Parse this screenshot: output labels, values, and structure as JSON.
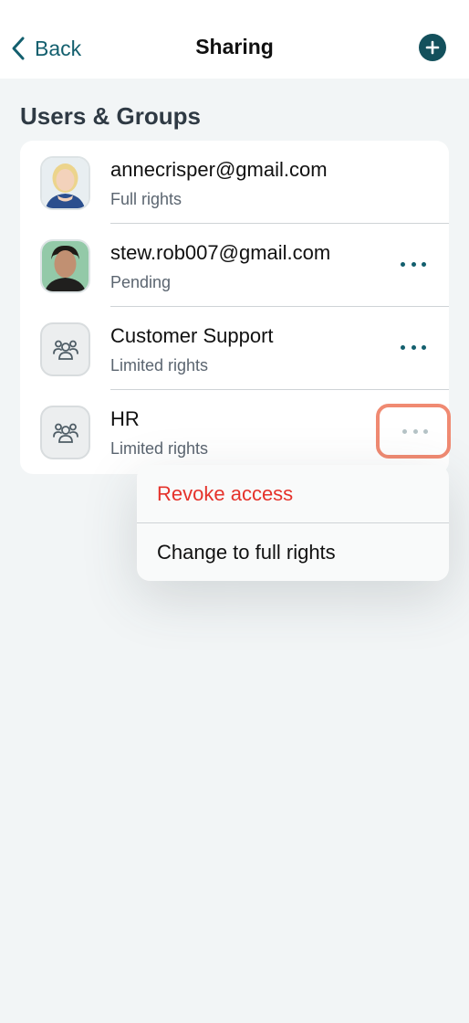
{
  "nav": {
    "back_label": "Back",
    "title": "Sharing",
    "accent": "#135f6e"
  },
  "section": {
    "title": "Users & Groups"
  },
  "rows": [
    {
      "name": "annecrisper@gmail.com",
      "subtitle": "Full rights",
      "avatar": "photo-woman"
    },
    {
      "name": "stew.rob007@gmail.com",
      "subtitle": "Pending",
      "avatar": "photo-man"
    },
    {
      "name": "Customer Support",
      "subtitle": "Limited rights",
      "avatar": "group-icon"
    },
    {
      "name": "HR",
      "subtitle": "Limited rights",
      "avatar": "group-icon"
    }
  ],
  "context_menu": {
    "revoke_label": "Revoke access",
    "change_label": "Change to full rights",
    "danger_color": "#e5322b"
  }
}
